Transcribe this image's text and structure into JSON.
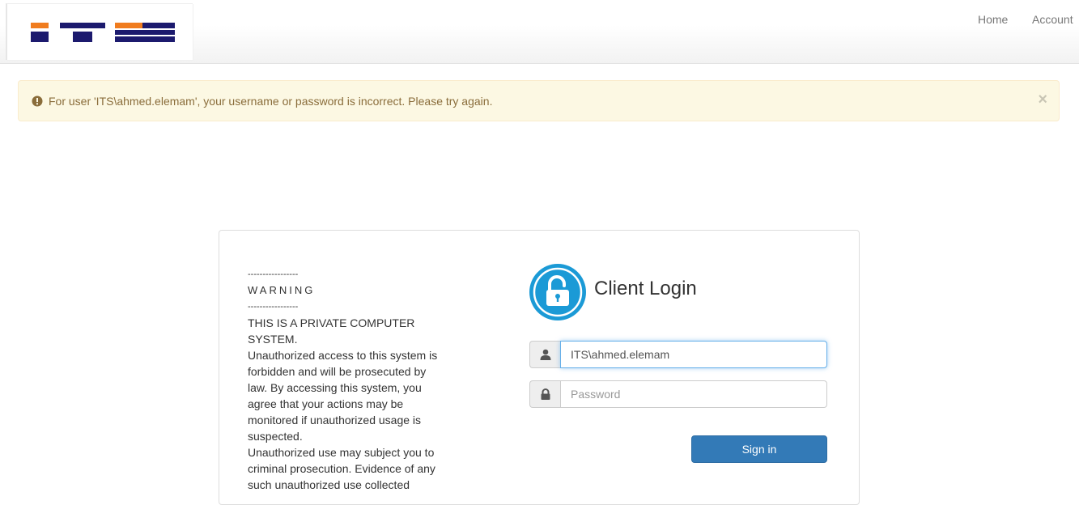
{
  "header": {
    "logo_text": "ITS",
    "nav": {
      "home": "Home",
      "account": "Account"
    }
  },
  "alert": {
    "message": "For user 'ITS\\ahmed.elemam', your username or password is incorrect. Please try again.",
    "close": "×"
  },
  "warning": {
    "dashes": "-----------------",
    "title": "WARNING",
    "paragraphs": [
      "THIS IS A PRIVATE COMPUTER SYSTEM.",
      "Unauthorized access to this system is forbidden and will be prosecuted by law. By accessing this system, you agree that your actions may be monitored if unauthorized usage is suspected.",
      "Unauthorized use may subject you to criminal prosecution. Evidence of any such unauthorized use collected"
    ]
  },
  "login": {
    "title": "Client Login",
    "username_value": "ITS\\ahmed.elemam",
    "password_placeholder": "Password",
    "signin_label": "Sign in"
  },
  "colors": {
    "accent": "#1b9ad6",
    "button": "#337ab7",
    "alert_bg": "#fcf8e3",
    "alert_text": "#8a6d3b",
    "logo_navy": "#1c1a6e",
    "logo_orange": "#f07c1e"
  }
}
